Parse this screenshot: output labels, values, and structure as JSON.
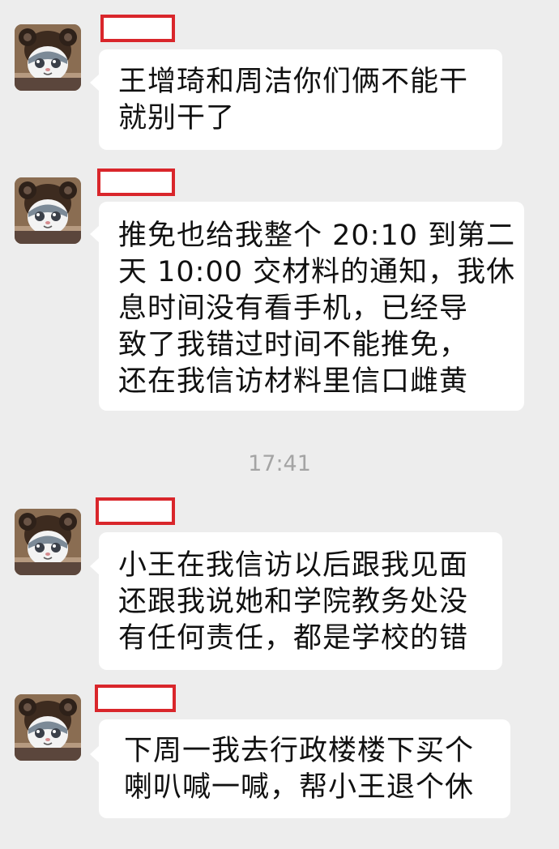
{
  "chat": {
    "messages": [
      {
        "text": "王增琦和周洁你们俩不能干\n就别干了"
      },
      {
        "text": "推免也给我整个 20:10 到第二\n天 10:00 交材料的通知，我休\n息时间没有看手机，已经导\n致了我错过时间不能推免，\n还在我信访材料里信口雌黄"
      },
      {
        "text": "小王在我信访以后跟我见面\n还跟我说她和学院教务处没\n有任何责任，都是学校的错"
      },
      {
        "text": "下周一我去行政楼楼下买个\n喇叭喊一喊，帮小王退个休"
      }
    ],
    "timestamp": "17:41"
  }
}
